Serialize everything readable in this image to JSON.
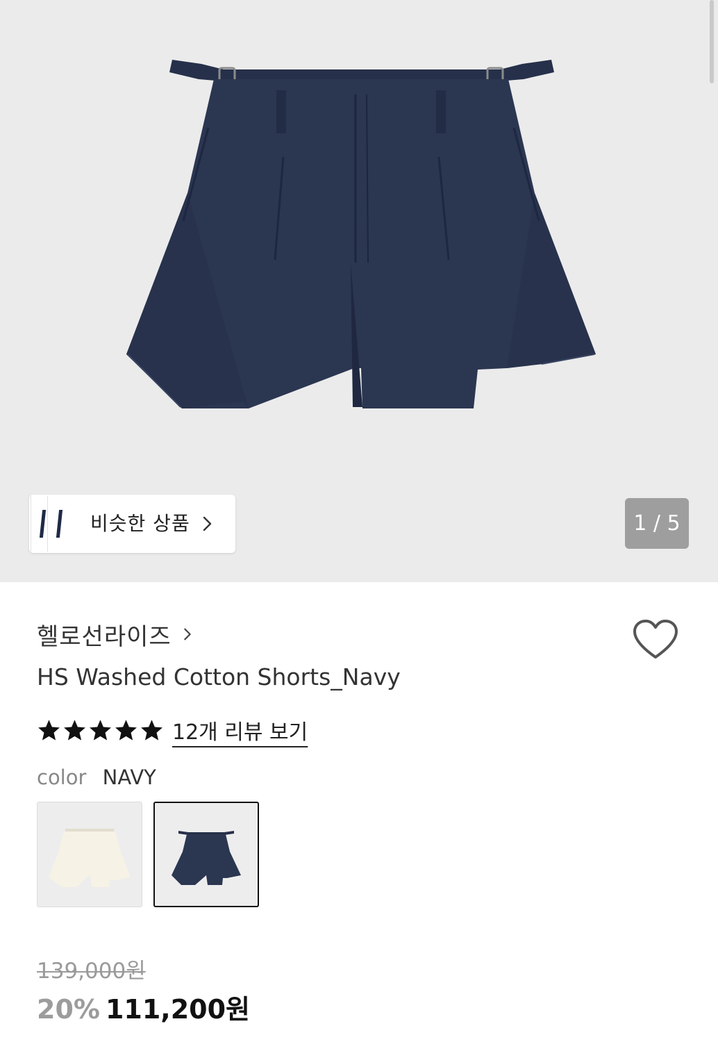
{
  "gallery": {
    "similar_label": "비슷한 상품",
    "page_indicator": "1 / 5",
    "product_color": "#2b3651"
  },
  "product": {
    "brand": "헬로선라이즈",
    "title": "HS Washed Cotton Shorts_Navy",
    "rating_stars": 5,
    "review_link": "12개 리뷰 보기",
    "color_label": "color",
    "color_value": "NAVY",
    "swatches": [
      {
        "name": "ivory",
        "color": "#f4f0e4",
        "selected": false
      },
      {
        "name": "navy",
        "color": "#2b3651",
        "selected": true
      }
    ],
    "original_price": "139,000원",
    "discount": "20%",
    "sale_price": "111,200원"
  }
}
